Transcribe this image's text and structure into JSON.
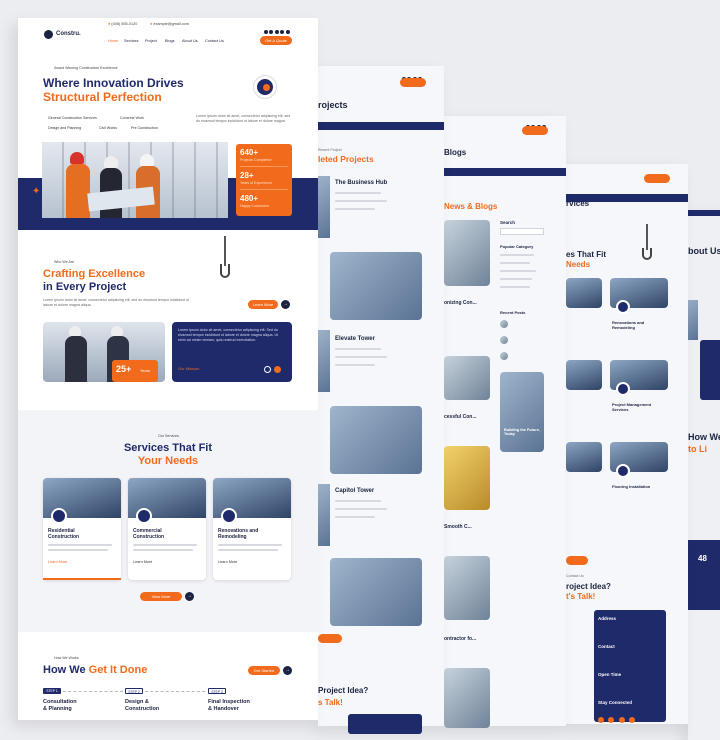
{
  "theme": {
    "navy": "#1f2a6b",
    "orange": "#f26a1b",
    "bg": "#ecedf1"
  },
  "home": {
    "topbar": {
      "phone": "(406) 555-0120",
      "email": "example@gmail.com"
    },
    "brand": "Constru.",
    "nav": [
      "Home",
      "Services",
      "Project",
      "Blogs",
      "About Us",
      "Contact Us"
    ],
    "nav_cta": "Get A Quote",
    "hero": {
      "eyebrow": "Award Winning Construction Excellence",
      "title_line1": "Where Innovation Drives",
      "title_line2": "Structural Perfection",
      "services": [
        "General Construction Services",
        "Concrete Work",
        "Design and Planning",
        "Civil Works",
        "Pre Construction"
      ],
      "lorem": "Lorem ipsum dolor sit amet, consectetur adipiscing elit, sed do eiusmod tempor incididunt ut labore et dolore magna",
      "stats": [
        {
          "value": "640+",
          "label": "Projects Completed"
        },
        {
          "value": "28+",
          "label": "Years of Experience"
        },
        {
          "value": "480+",
          "label": "Happy Customers"
        }
      ]
    },
    "who": {
      "eyebrow": "Who We Are",
      "title_line1": "Crafting Excellence",
      "title_line2": "in Every Project",
      "lorem": "Lorem ipsum dolor sit amet, consectetur adipiscing elit, sed do eiusmod tempor incididunt ut labore et dolore magna aliqua.",
      "cta": "Learn More",
      "badge_value": "25+",
      "badge_label": "Years",
      "mission_text": "Lorem ipsum dolor sit amet, consectetur adipiscing elit. Sed do eiusmod tempor incididunt ut labore et dolore magna aliqua. Ut enim ad minim veniam, quis nostrud exercitation.",
      "mission_label": "Our Mission"
    },
    "services": {
      "eyebrow": "Our Services",
      "title_line1": "Services That Fit",
      "title_line2": "Your Needs",
      "items": [
        {
          "name_1": "Residential",
          "name_2": "Construction",
          "link": "Learn More"
        },
        {
          "name_1": "Commercial",
          "name_2": "Construction",
          "link": "Learn More"
        },
        {
          "name_1": "Renovations and",
          "name_2": "Remodeling",
          "link": "Learn More"
        }
      ],
      "cta": "View More"
    },
    "how": {
      "eyebrow": "How We Works",
      "title_a": "How We ",
      "title_b": "Get It Done",
      "cta": "Get Started",
      "steps": [
        {
          "tag": "STEP 1",
          "name_1": "Consultation",
          "name_2": "& Planning"
        },
        {
          "tag": "STEP 2",
          "name_1": "Design &",
          "name_2": "Construction"
        },
        {
          "tag": "STEP 3",
          "name_1": "Final Inspection",
          "name_2": "& Handover"
        }
      ]
    }
  },
  "projects_page": {
    "title": "rojects",
    "eyebrow": "Recent Project",
    "heading": "leted Projects",
    "items": [
      "The Business Hub",
      "Elevate Tower",
      "Capitol Tower"
    ],
    "cta_heading_1": "Project Idea?",
    "cta_heading_2": "s Talk!"
  },
  "blogs_page": {
    "title": "Blogs",
    "heading": "News & Blogs",
    "search_label": "Search",
    "category_label": "Popular Category",
    "recent_label": "Recent Posts",
    "posts": [
      "onizing Con...",
      "cessful Con...",
      "Smooth C...",
      "ontractor fo..."
    ],
    "feature_caption": "Building the Future, Today"
  },
  "services_page": {
    "title": "rvices",
    "heading_1": "es That Fit",
    "heading_2": "Needs",
    "items": [
      "Renovations and Remodeling",
      "Project Management Services",
      "Flooring Installation"
    ],
    "contact_eyebrow": "Contact Us",
    "contact_heading_1": "roject Idea?",
    "contact_heading_2": "t's Talk!",
    "info": [
      "Address",
      "Contact",
      "Open Time",
      "Stay Connected"
    ]
  },
  "about_page": {
    "title": "bout Us",
    "heading": "How We",
    "heading_2": "to Li",
    "stat": "48"
  }
}
